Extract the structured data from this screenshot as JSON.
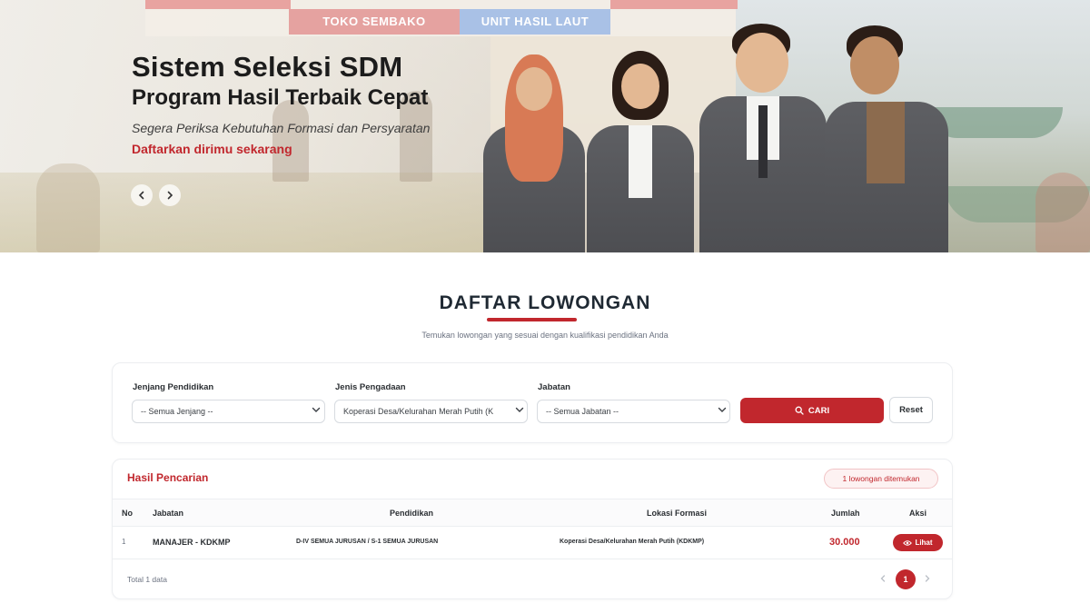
{
  "hero": {
    "sign_left": "TOKO SEMBAKO",
    "sign_right": "UNIT HASIL LAUT",
    "title": "Sistem Seleksi SDM",
    "subtitle": "Program Hasil Terbaik Cepat",
    "tagline": "Segera Periksa Kebutuhan Formasi dan Persyaratan",
    "cta": "Daftarkan dirimu sekarang",
    "prev_icon": "chevron-left-icon",
    "next_icon": "chevron-right-icon"
  },
  "section": {
    "title": "DAFTAR LOWONGAN",
    "description": "Temukan lowongan yang sesuai dengan kualifikasi pendidikan Anda"
  },
  "filters": {
    "jenjang": {
      "label": "Jenjang Pendidikan",
      "value": "-- Semua Jenjang --"
    },
    "pengadaan": {
      "label": "Jenis Pengadaan",
      "value": "Koperasi Desa/Kelurahan Merah Putih (K"
    },
    "jabatan": {
      "label": "Jabatan",
      "value": "-- Semua Jabatan --"
    },
    "search_label": "CARI",
    "reset_label": "Reset"
  },
  "results": {
    "title": "Hasil Pencarian",
    "badge": "1 lowongan ditemukan",
    "columns": [
      "No",
      "Jabatan",
      "Pendidikan",
      "Lokasi Formasi",
      "Jumlah",
      "Aksi"
    ],
    "rows": [
      {
        "no": "1",
        "jabatan": "MANAJER - KDKMP",
        "pendidikan": "D-IV SEMUA JURUSAN / S-1 SEMUA JURUSAN",
        "lokasi": "Koperasi Desa/Kelurahan Merah Putih (KDKMP)",
        "jumlah": "30.000",
        "action": "Lihat"
      }
    ],
    "total": "Total 1 data",
    "current_page": "1"
  },
  "colors": {
    "accent": "#c1272d",
    "text": "#1f2933"
  }
}
